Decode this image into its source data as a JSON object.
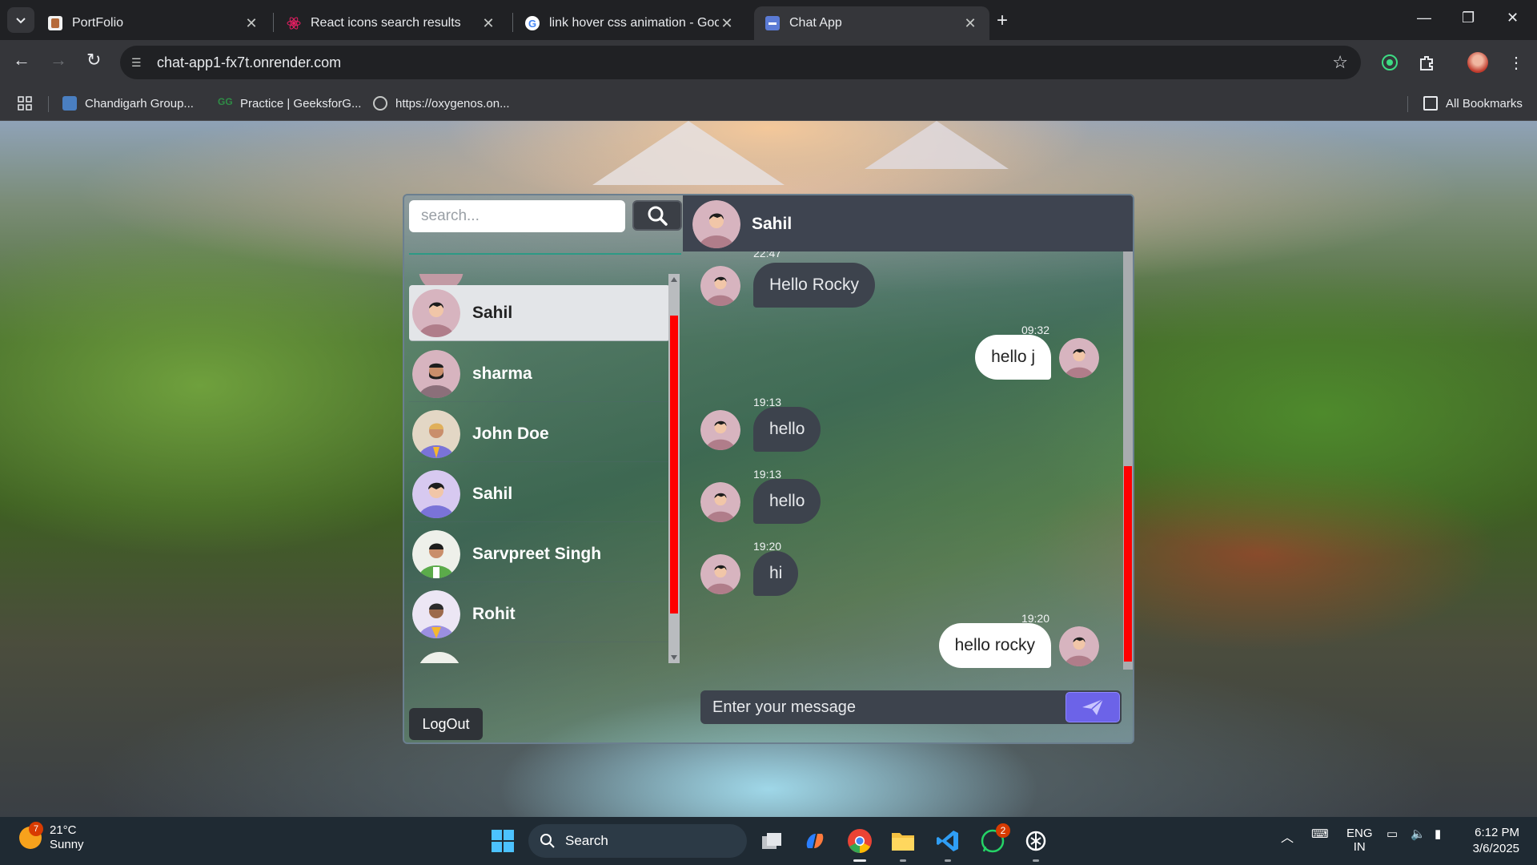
{
  "browser": {
    "tabs": [
      {
        "title": "PortFolio",
        "active": false
      },
      {
        "title": "React icons search results",
        "active": false
      },
      {
        "title": "link hover css animation - Goog",
        "active": false
      },
      {
        "title": "Chat App",
        "active": true
      }
    ],
    "url": "chat-app1-fx7t.onrender.com",
    "bookmarks": [
      "Chandigarh Group...",
      "Practice | GeeksforG...",
      "https://oxygenos.on..."
    ],
    "all_bookmarks": "All Bookmarks"
  },
  "app": {
    "search_placeholder": "search...",
    "users": [
      {
        "name": "Sahil",
        "selected": true
      },
      {
        "name": "sharma",
        "selected": false
      },
      {
        "name": "John Doe",
        "selected": false
      },
      {
        "name": "Sahil",
        "selected": false
      },
      {
        "name": "Sarvpreet Singh",
        "selected": false
      },
      {
        "name": "Rohit",
        "selected": false
      }
    ],
    "logout_label": "LogOut",
    "chat_header_name": "Sahil",
    "messages": [
      {
        "time": "22:47",
        "text": "Hello Rocky",
        "direction": "in"
      },
      {
        "time": "09:32",
        "text": "hello j",
        "direction": "out"
      },
      {
        "time": "19:13",
        "text": "hello",
        "direction": "in"
      },
      {
        "time": "19:13",
        "text": "hello",
        "direction": "in"
      },
      {
        "time": "19:20",
        "text": "hi",
        "direction": "in"
      },
      {
        "time": "19:20",
        "text": "hello rocky",
        "direction": "out"
      }
    ],
    "composer_placeholder": "Enter your message",
    "colors": {
      "accent_send": "#6c63e8",
      "scrollbar_thumb": "#ff0000",
      "divider": "#2d9a85"
    }
  },
  "taskbar": {
    "weather_badge": "7",
    "temperature": "21°C",
    "condition": "Sunny",
    "search_label": "Search",
    "whatsapp_badge": "2",
    "lang_line1": "ENG",
    "lang_line2": "IN",
    "time": "6:12 PM",
    "date": "3/6/2025"
  }
}
